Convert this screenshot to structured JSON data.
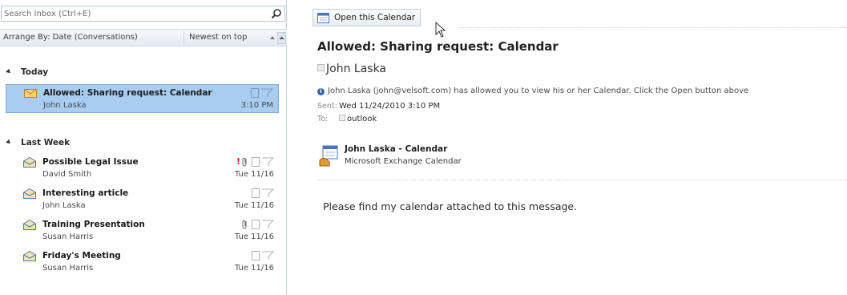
{
  "search": {
    "placeholder": "Search Inbox (Ctrl+E)"
  },
  "arrange": {
    "by_label": "Arrange By: Date (Conversations)",
    "order_label": "Newest on top"
  },
  "groups": [
    {
      "label": "Today"
    },
    {
      "label": "Last Week"
    }
  ],
  "messages": [
    {
      "subject": "Allowed: Sharing request: Calendar",
      "sender": "John Laska",
      "date": "3:10 PM",
      "selected": true
    },
    {
      "subject": "Possible Legal Issue",
      "sender": "David Smith",
      "date": "Tue 11/16",
      "importance": "!"
    },
    {
      "subject": "Interesting article",
      "sender": "John Laska",
      "date": "Tue 11/16"
    },
    {
      "subject": "Training Presentation",
      "sender": "Susan Harris",
      "date": "Tue 11/16"
    },
    {
      "subject": "Friday's Meeting",
      "sender": "Susan Harris",
      "date": "Tue 11/16"
    }
  ],
  "reading": {
    "open_button": "Open this Calendar",
    "subject": "Allowed: Sharing request: Calendar",
    "from": "John Laska",
    "info": "John Laska (john@velsoft.com) has allowed you to view his or her Calendar.  Click the Open button above",
    "sent_label": "Sent:",
    "sent_value": "Wed 11/24/2010 3:10 PM",
    "to_label": "To:",
    "to_value": "outlook",
    "attachment_title": "John Laska - Calendar",
    "attachment_subtitle": "Microsoft Exchange Calendar",
    "body": "Please find my calendar attached to this message."
  },
  "colors": {
    "selection": "#a9cdf0",
    "accent": "#2e67b1",
    "importance": "#d01f1f"
  }
}
